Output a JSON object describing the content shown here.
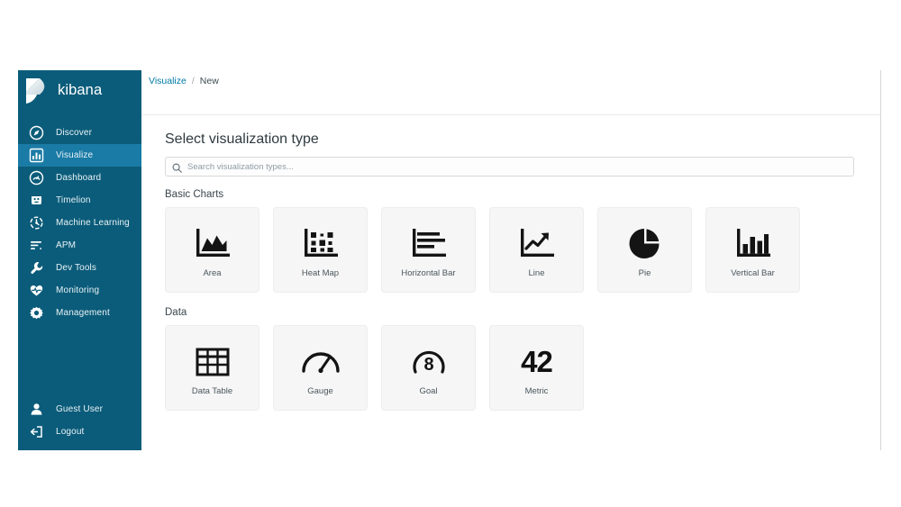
{
  "sidebar": {
    "brand": "kibana",
    "brand_logo_icon": "kibana-logo-icon",
    "background_color": "#0b5c7a",
    "active_color": "#1a7ba6",
    "items": [
      {
        "label": "Discover",
        "icon": "compass-icon",
        "active": false
      },
      {
        "label": "Visualize",
        "icon": "bar-chart-icon",
        "active": true
      },
      {
        "label": "Dashboard",
        "icon": "dashboard-icon",
        "active": false
      },
      {
        "label": "Timelion",
        "icon": "timelion-icon",
        "active": false
      },
      {
        "label": "Machine Learning",
        "icon": "gears-icon",
        "active": false
      },
      {
        "label": "APM",
        "icon": "apm-icon",
        "active": false
      },
      {
        "label": "Dev Tools",
        "icon": "wrench-icon",
        "active": false
      },
      {
        "label": "Monitoring",
        "icon": "heartbeat-icon",
        "active": false
      },
      {
        "label": "Management",
        "icon": "gear-icon",
        "active": false
      }
    ],
    "bottom_items": [
      {
        "label": "Guest User",
        "icon": "user-icon"
      },
      {
        "label": "Logout",
        "icon": "logout-icon"
      }
    ]
  },
  "breadcrumb": {
    "parent": "Visualize",
    "separator": "/",
    "current": "New",
    "link_color": "#0079a5"
  },
  "main": {
    "title": "Select visualization type",
    "search": {
      "placeholder": "Search visualization types...",
      "value": "",
      "icon": "search-icon"
    },
    "groups": [
      {
        "title": "Basic Charts",
        "cards": [
          {
            "label": "Area",
            "icon": "area-chart-icon"
          },
          {
            "label": "Heat Map",
            "icon": "heat-map-icon"
          },
          {
            "label": "Horizontal Bar",
            "icon": "horizontal-bar-icon"
          },
          {
            "label": "Line",
            "icon": "line-chart-icon"
          },
          {
            "label": "Pie",
            "icon": "pie-chart-icon"
          },
          {
            "label": "Vertical Bar",
            "icon": "vertical-bar-icon"
          }
        ]
      },
      {
        "title": "Data",
        "cards": [
          {
            "label": "Data Table",
            "icon": "data-table-icon"
          },
          {
            "label": "Gauge",
            "icon": "gauge-icon"
          },
          {
            "label": "Goal",
            "icon": "goal-icon",
            "glyph": "8"
          },
          {
            "label": "Metric",
            "icon": "metric-icon",
            "glyph": "42"
          }
        ]
      }
    ]
  }
}
